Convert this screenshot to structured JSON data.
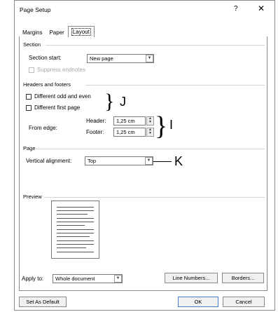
{
  "window": {
    "title": "Page Setup",
    "help": "?",
    "close": "✕"
  },
  "tabs": [
    {
      "label": "Margins"
    },
    {
      "label": "Paper"
    },
    {
      "label": "Layout"
    }
  ],
  "section": {
    "title": "Section",
    "start_label": "Section start:",
    "start_value": "New page",
    "suppress_label": "Suppress endnotes"
  },
  "headers_footers": {
    "title": "Headers and footers",
    "odd_even_label": "Different odd and even",
    "first_page_label": "Different first page",
    "from_edge_label": "From edge:",
    "header_label": "Header:",
    "header_value": "1,25 cm",
    "footer_label": "Footer:",
    "footer_value": "1,25 cm"
  },
  "page": {
    "title": "Page",
    "valign_label": "Vertical alignment:",
    "valign_value": "Top"
  },
  "preview": {
    "title": "Preview"
  },
  "apply": {
    "label": "Apply to:",
    "value": "Whole document",
    "line_numbers_label": "Line Numbers...",
    "borders_label": "Borders..."
  },
  "footer_buttons": {
    "default_label": "Set As Default",
    "ok_label": "OK",
    "cancel_label": "Cancel"
  },
  "annotations": {
    "j": "J",
    "i": "I",
    "k": "K"
  },
  "icons": {
    "dropdown": "chevron-down-icon",
    "spinner": "spinner-arrows-icon"
  }
}
